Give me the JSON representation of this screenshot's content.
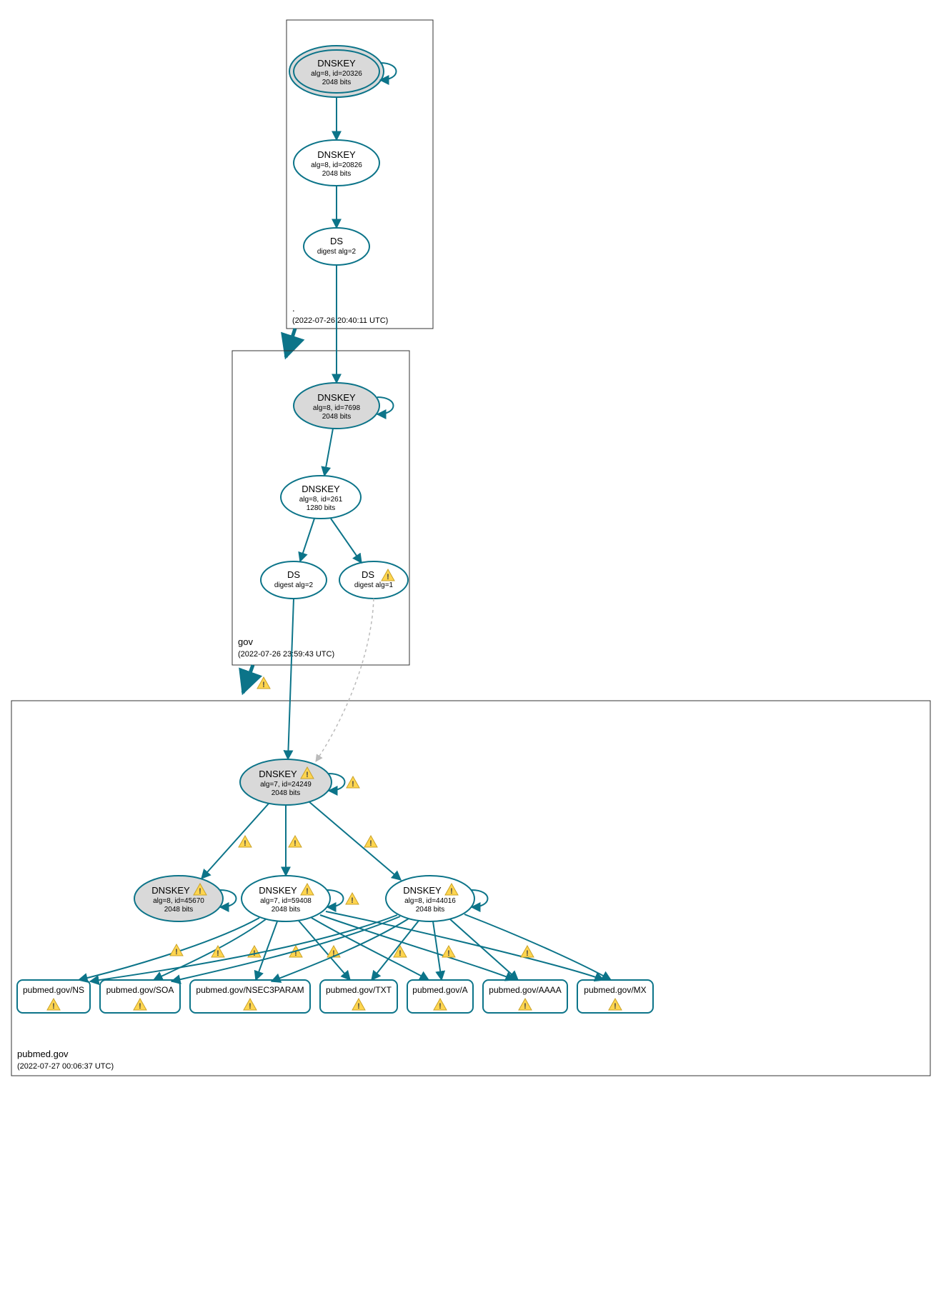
{
  "zones": {
    "root": {
      "name": ".",
      "timestamp": "(2022-07-26 20:40:11 UTC)"
    },
    "gov": {
      "name": "gov",
      "timestamp": "(2022-07-26 23:59:43 UTC)"
    },
    "pubmed": {
      "name": "pubmed.gov",
      "timestamp": "(2022-07-27 00:06:37 UTC)"
    }
  },
  "nodes": {
    "root_ksk": {
      "title": "DNSKEY",
      "line2": "alg=8, id=20326",
      "line3": "2048 bits"
    },
    "root_zsk": {
      "title": "DNSKEY",
      "line2": "alg=8, id=20826",
      "line3": "2048 bits"
    },
    "root_ds": {
      "title": "DS",
      "line2": "digest alg=2"
    },
    "gov_ksk": {
      "title": "DNSKEY",
      "line2": "alg=8, id=7698",
      "line3": "2048 bits"
    },
    "gov_zsk": {
      "title": "DNSKEY",
      "line2": "alg=8, id=261",
      "line3": "1280 bits"
    },
    "gov_ds2": {
      "title": "DS",
      "line2": "digest alg=2"
    },
    "gov_ds1": {
      "title": "DS",
      "line2": "digest alg=1"
    },
    "pub_ksk": {
      "title": "DNSKEY",
      "line2": "alg=7, id=24249",
      "line3": "2048 bits"
    },
    "pub_key1": {
      "title": "DNSKEY",
      "line2": "alg=8, id=45670",
      "line3": "2048 bits"
    },
    "pub_key2": {
      "title": "DNSKEY",
      "line2": "alg=7, id=59408",
      "line3": "2048 bits"
    },
    "pub_key3": {
      "title": "DNSKEY",
      "line2": "alg=8, id=44016",
      "line3": "2048 bits"
    }
  },
  "rrsets": {
    "ns": "pubmed.gov/NS",
    "soa": "pubmed.gov/SOA",
    "nsec": "pubmed.gov/NSEC3PARAM",
    "txt": "pubmed.gov/TXT",
    "a": "pubmed.gov/A",
    "aaaa": "pubmed.gov/AAAA",
    "mx": "pubmed.gov/MX"
  },
  "warn_glyph": "⚠"
}
